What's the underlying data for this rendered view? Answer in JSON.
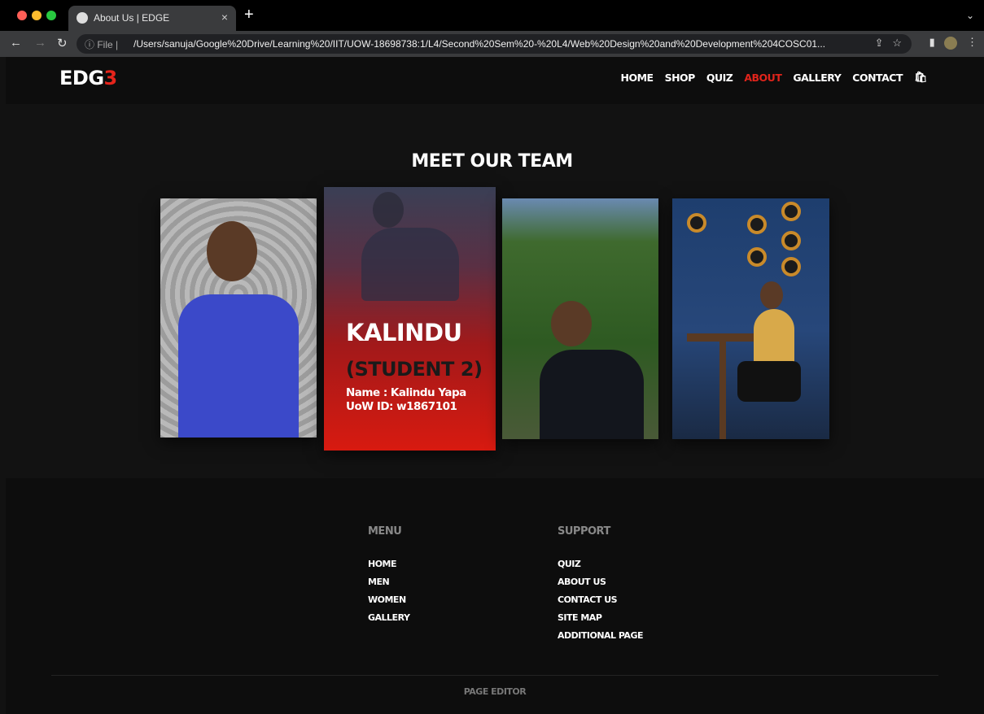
{
  "browser": {
    "tab_title": "About Us | EDGE",
    "close_glyph": "×",
    "new_tab_glyph": "+",
    "info_label": "ⓘ File |",
    "url": "/Users/sanuja/Google%20Drive/Learning%20/IIT/UOW-18698738:1/L4/Second%20Sem%20-%20L4/Web%20Design%20and%20Development%204COSC01..."
  },
  "header": {
    "logo_main": "EDG",
    "logo_accent": "3",
    "nav": [
      "HOME",
      "SHOP",
      "QUIZ",
      "ABOUT",
      "GALLERY",
      "CONTACT"
    ],
    "active_nav": "ABOUT",
    "bag_icon": "cart-bag-icon"
  },
  "main": {
    "title": "MEET OUR TEAM",
    "featured_card": {
      "name": "KALINDU",
      "role": "(STUDENT 2)",
      "full_name": "Name : Kalindu Yapa",
      "uow_id": "UoW ID: w1867101"
    }
  },
  "footer": {
    "menu": {
      "heading": "MENU",
      "items": [
        "HOME",
        "MEN",
        "WOMEN",
        "GALLERY"
      ]
    },
    "support": {
      "heading": "SUPPORT",
      "items": [
        "QUIZ",
        "ABOUT US",
        "CONTACT US",
        "SITE MAP",
        "ADDITIONAL PAGE"
      ]
    },
    "page_editor": "PAGE EDITOR"
  },
  "colors": {
    "accent": "#e5241b",
    "background": "#121212"
  }
}
